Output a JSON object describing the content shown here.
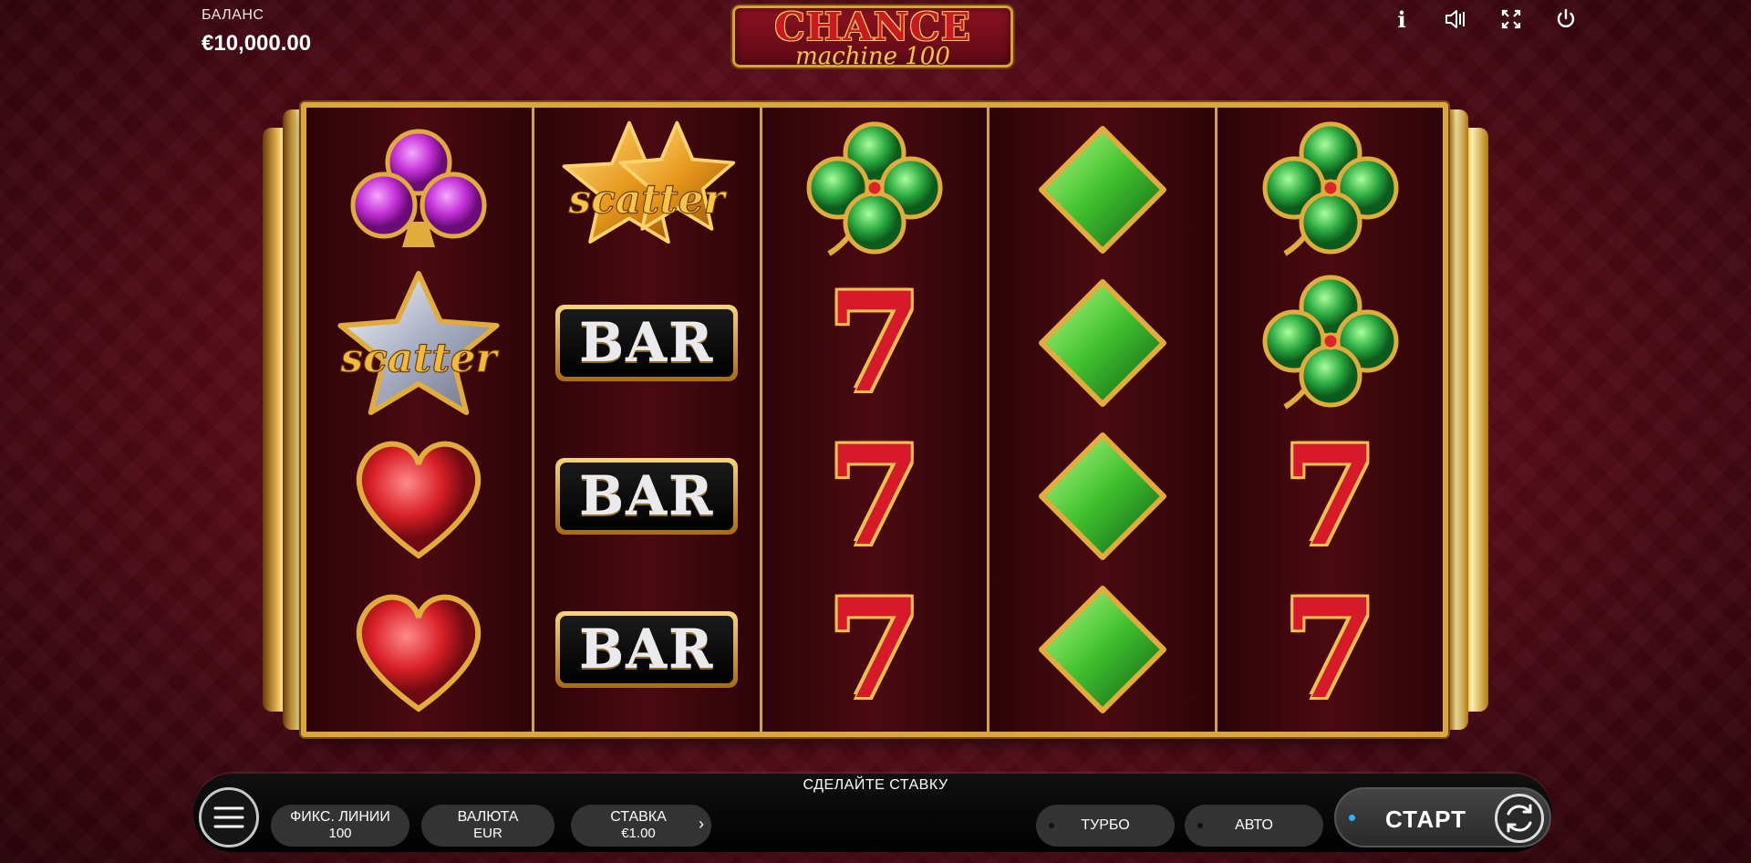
{
  "balance": {
    "label": "БАЛАНС",
    "value": "€10,000.00"
  },
  "logo": {
    "title": "CHANCE",
    "subtitle": "machine 100"
  },
  "top_icons": [
    "info-icon",
    "sound-icon",
    "fullscreen-icon",
    "power-icon"
  ],
  "info_glyph": "i",
  "reels": [
    [
      "club",
      "scatter-silver",
      "heart",
      "heart"
    ],
    [
      "scatter-gold",
      "bar",
      "bar",
      "bar"
    ],
    [
      "clover",
      "seven",
      "seven",
      "seven"
    ],
    [
      "diamond",
      "diamond",
      "diamond",
      "diamond"
    ],
    [
      "clover",
      "clover",
      "seven",
      "seven"
    ]
  ],
  "symbols": {
    "bar_text": "BAR",
    "scatter_text": "scatter",
    "seven_text": "7"
  },
  "colors": {
    "club": "#c93bd6",
    "heart": "#e02a2a",
    "clover": "#2fb54a",
    "diamond": "#3fbf2e",
    "gold": "#e2ac3c",
    "silver": "#cfd3de"
  },
  "bottom": {
    "prompt": "СДЕЛАЙТЕ СТАВКУ",
    "lines_label": "ФИКС. ЛИНИИ",
    "lines_value": "100",
    "currency_label": "ВАЛЮТА",
    "currency_value": "EUR",
    "bet_label": "СТАВКА",
    "bet_value": "€1.00",
    "bet_arrow": "›",
    "turbo": "ТУРБО",
    "auto": "АВТО",
    "start": "СТАРТ"
  }
}
